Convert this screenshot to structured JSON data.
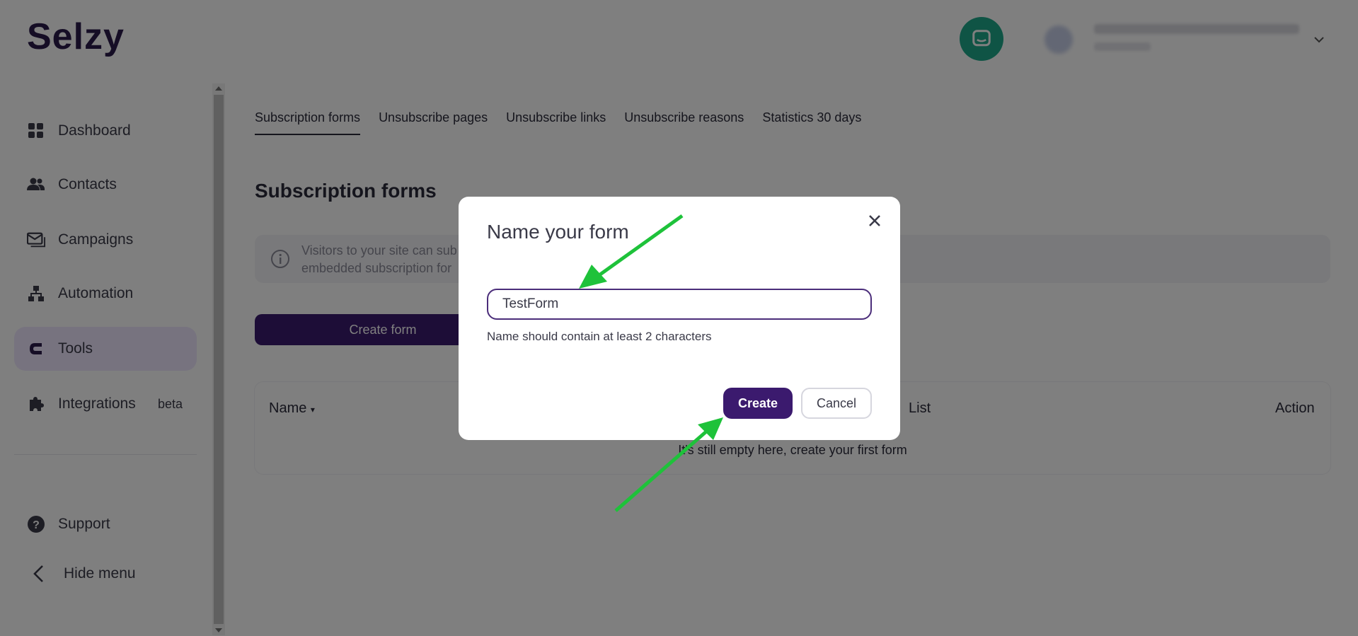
{
  "app": {
    "logo_text": "Selzy",
    "brand_color": "#3b1a6e",
    "accent_color": "#2bb673",
    "chat_color": "#1fa88a"
  },
  "header": {
    "chat_icon": "chat-bubble-icon",
    "account_dropdown_icon": "chevron-down-icon"
  },
  "sidebar": {
    "items": [
      {
        "label": "Dashboard",
        "icon": "grid-icon"
      },
      {
        "label": "Contacts",
        "icon": "people-icon"
      },
      {
        "label": "Campaigns",
        "icon": "envelope-icon"
      },
      {
        "label": "Automation",
        "icon": "flow-icon"
      },
      {
        "label": "Tools",
        "icon": "magnet-icon",
        "active": true
      },
      {
        "label": "Integrations",
        "icon": "puzzle-icon",
        "badge": "beta"
      }
    ],
    "support_label": "Support",
    "hide_menu_label": "Hide menu"
  },
  "main": {
    "tabs": [
      {
        "label": "Subscription forms",
        "active": true
      },
      {
        "label": "Unsubscribe pages"
      },
      {
        "label": "Unsubscribe links"
      },
      {
        "label": "Unsubscribe reasons"
      },
      {
        "label": "Statistics 30 days"
      }
    ],
    "title": "Subscription forms",
    "info_text": "Visitors to your site can sub",
    "info_text_2": "embedded subscription for",
    "create_form_label": "Create form",
    "table": {
      "columns": [
        "Name",
        "List",
        "Action"
      ],
      "empty_message": "It's still empty here, create your first form"
    }
  },
  "modal": {
    "title": "Name your form",
    "input_value": "TestForm",
    "hint": "Name should contain at least 2 characters",
    "create_label": "Create",
    "cancel_label": "Cancel"
  },
  "annotations": {
    "arrow_color": "#1ec23a"
  }
}
